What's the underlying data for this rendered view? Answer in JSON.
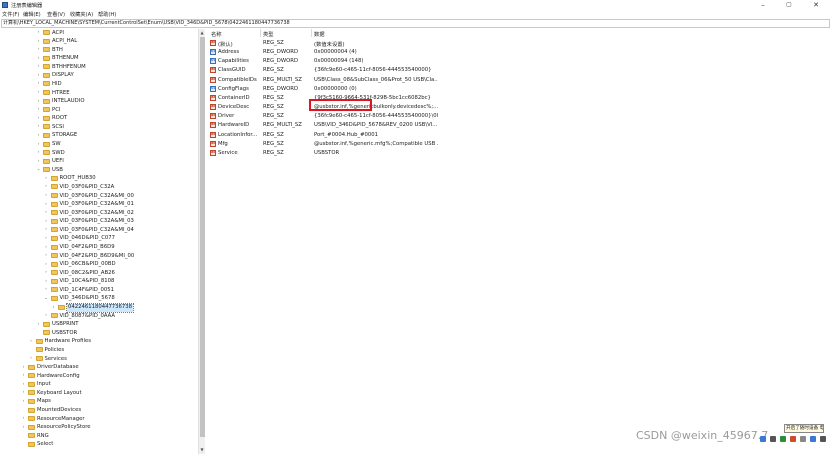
{
  "window": {
    "title": "注册表编辑器",
    "controls": [
      "–",
      "▢",
      "✕"
    ]
  },
  "menu": [
    "文件(F)",
    "编辑(E)",
    "查看(V)",
    "收藏夹(A)",
    "帮助(H)"
  ],
  "address": "计算机\\HKEY_LOCAL_MACHINE\\SYSTEM\\CurrentControlSet\\Enum\\USB\\VID_346D&PID_5678\\0422461180447736738",
  "tree": [
    {
      "label": "ACPI",
      "exp": ">"
    },
    {
      "label": "ACPI_HAL",
      "exp": ">"
    },
    {
      "label": "BTH",
      "exp": ">"
    },
    {
      "label": "BTHENUM",
      "exp": ">"
    },
    {
      "label": "BTHHFENUM",
      "exp": ">"
    },
    {
      "label": "DISPLAY",
      "exp": ">"
    },
    {
      "label": "HID",
      "exp": ">"
    },
    {
      "label": "HTREE",
      "exp": ">"
    },
    {
      "label": "INTELAUDIO",
      "exp": ">"
    },
    {
      "label": "PCI",
      "exp": ">"
    },
    {
      "label": "ROOT",
      "exp": ">"
    },
    {
      "label": "SCSI",
      "exp": ">"
    },
    {
      "label": "STORAGE",
      "exp": ">"
    },
    {
      "label": "SW",
      "exp": ">"
    },
    {
      "label": "SWD",
      "exp": ">"
    },
    {
      "label": "UEFI",
      "exp": ">"
    },
    {
      "label": "USB",
      "exp": "v"
    },
    {
      "label": "ROOT_HUB30",
      "exp": ">"
    },
    {
      "label": "VID_03F0&PID_C32A",
      "exp": ">"
    },
    {
      "label": "VID_03F0&PID_C32A&MI_00",
      "exp": ">"
    },
    {
      "label": "VID_03F0&PID_C32A&MI_01",
      "exp": ">"
    },
    {
      "label": "VID_03F0&PID_C32A&MI_02",
      "exp": ">"
    },
    {
      "label": "VID_03F0&PID_C32A&MI_03",
      "exp": ">"
    },
    {
      "label": "VID_03F0&PID_C32A&MI_04",
      "exp": ">"
    },
    {
      "label": "VID_046D&PID_C077",
      "exp": ">"
    },
    {
      "label": "VID_04F2&PID_B6D9",
      "exp": ">"
    },
    {
      "label": "VID_04F2&PID_B6D9&MI_00",
      "exp": ">"
    },
    {
      "label": "VID_06CB&PID_00BD",
      "exp": ">"
    },
    {
      "label": "VID_08C2&PID_AB26",
      "exp": ">"
    },
    {
      "label": "VID_10C4&PID_8108",
      "exp": ">"
    },
    {
      "label": "VID_1C4F&PID_0051",
      "exp": ">"
    },
    {
      "label": "VID_346D&PID_5678",
      "exp": "v"
    },
    {
      "label": "0422461180447736738",
      "exp": ">"
    },
    {
      "label": "VID_8087&PID_0AAA",
      "exp": ">"
    },
    {
      "label": "USBPRINT",
      "exp": ">"
    },
    {
      "label": "USBSTOR",
      "exp": ""
    },
    {
      "label": "Hardware Profiles",
      "exp": ">"
    },
    {
      "label": "Policies",
      "exp": ""
    },
    {
      "label": "Services",
      "exp": ">"
    },
    {
      "label": "DriverDatabase",
      "exp": ">"
    },
    {
      "label": "HardwareConfig",
      "exp": ">"
    },
    {
      "label": "Input",
      "exp": ">"
    },
    {
      "label": "Keyboard Layout",
      "exp": ">"
    },
    {
      "label": "Maps",
      "exp": ">"
    },
    {
      "label": "MountedDevices",
      "exp": ""
    },
    {
      "label": "ResourceManager",
      "exp": ">"
    },
    {
      "label": "ResourcePolicyStore",
      "exp": ">"
    },
    {
      "label": "RNG",
      "exp": ""
    },
    {
      "label": "Select",
      "exp": ""
    }
  ],
  "columns": {
    "name": "名称",
    "type": "类型",
    "data": "数据"
  },
  "values": [
    {
      "name": "(默认)",
      "type": "REG_SZ",
      "data": "(数值未设置)",
      "icon": "string-value-icon"
    },
    {
      "name": "Address",
      "type": "REG_DWORD",
      "data": "0x00000004 (4)",
      "icon": "dword-value-icon"
    },
    {
      "name": "Capabilities",
      "type": "REG_DWORD",
      "data": "0x00000094 (148)",
      "icon": "dword-value-icon"
    },
    {
      "name": "ClassGUID",
      "type": "REG_SZ",
      "data": "{36fc9e60-c465-11cf-8056-444553540000}",
      "icon": "string-value-icon"
    },
    {
      "name": "CompatibleIDs",
      "type": "REG_MULTI_SZ",
      "data": "USB\\Class_08&SubClass_06&Prot_50 USB\\Cla...",
      "icon": "string-value-icon"
    },
    {
      "name": "ConfigFlags",
      "type": "REG_DWORD",
      "data": "0x00000000 (0)",
      "icon": "dword-value-icon"
    },
    {
      "name": "ContainerID",
      "type": "REG_SZ",
      "data": "{9f3c5160-9664-531f-829B-5bc1cc6082bc}",
      "icon": "string-value-icon"
    },
    {
      "name": "DeviceDesc",
      "type": "REG_SZ",
      "data": "@usbstor.inf,%genericbulkonly.devicedesc%;...",
      "icon": "string-value-icon"
    },
    {
      "name": "Driver",
      "type": "REG_SZ",
      "data": "{36fc9e60-c465-11cf-8056-444553540000}\\0004",
      "icon": "string-value-icon"
    },
    {
      "name": "HardwareID",
      "type": "REG_MULTI_SZ",
      "data": "USB\\VID_346D&PID_5678&REV_0200 USB\\VI...",
      "icon": "string-value-icon"
    },
    {
      "name": "LocationInfor...",
      "type": "REG_SZ",
      "data": "Port_#0004.Hub_#0001",
      "icon": "string-value-icon"
    },
    {
      "name": "Mfg",
      "type": "REG_SZ",
      "data": "@usbstor.inf,%generic.mfg%;Compatible USB ...",
      "icon": "string-value-icon"
    },
    {
      "name": "Service",
      "type": "REG_SZ",
      "data": "USBSTOR",
      "icon": "string-value-icon"
    }
  ],
  "watermark": "CSDN @weixin_45967.7",
  "tray": {
    "tip": "开启了随时设备 电"
  }
}
